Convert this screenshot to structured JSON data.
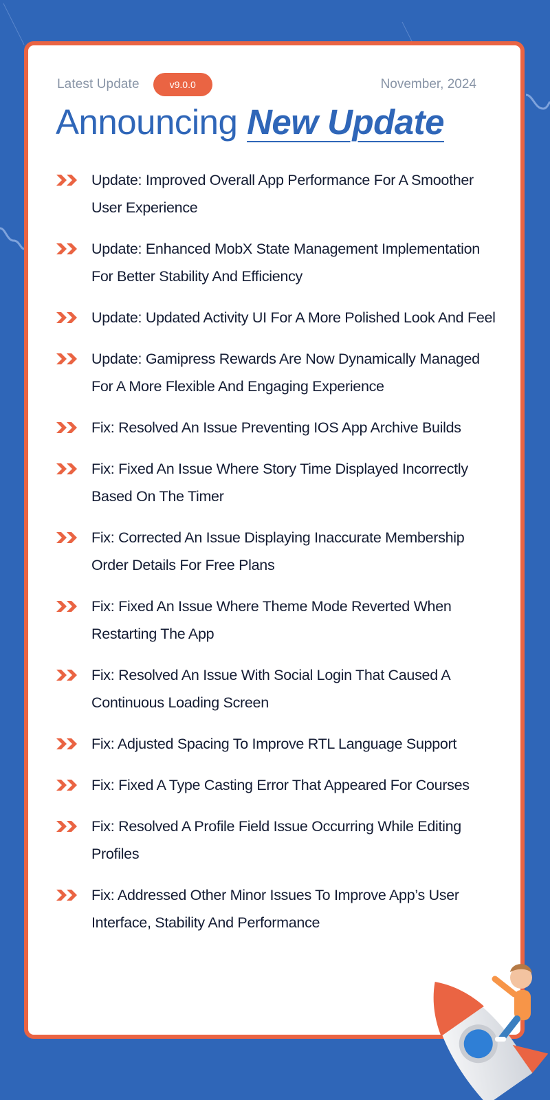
{
  "header": {
    "latest_label": "Latest Update",
    "version": "v9.0.0",
    "date": "November, 2024",
    "headline_plain": "Announcing",
    "headline_accent": "New Update"
  },
  "colors": {
    "background": "#2f66b8",
    "accent": "#ea6443",
    "text": "#141c33",
    "muted": "#8894a6"
  },
  "bullet_icon": "double-chevron-right-icon",
  "items": [
    {
      "text": "Update: Improved Overall App Performance For A Smoother User Experience"
    },
    {
      "text": "Update: Enhanced MobX State Management Implementation For Better Stability And Efficiency"
    },
    {
      "text": "Update: Updated Activity UI For A More Polished Look And Feel"
    },
    {
      "text": "Update: Gamipress Rewards Are Now Dynamically Managed For A More Flexible And Engaging Experience"
    },
    {
      "text": "Fix: Resolved An Issue Preventing IOS App Archive Builds"
    },
    {
      "text": "Fix: Fixed An Issue Where Story Time Displayed Incorrectly Based On The Timer"
    },
    {
      "text": "Fix: Corrected An Issue Displaying Inaccurate Membership Order Details For Free Plans"
    },
    {
      "text": "Fix: Fixed An Issue Where Theme Mode Reverted When Restarting The App"
    },
    {
      "text": "Fix: Resolved An Issue With Social Login That Caused A Continuous Loading Screen"
    },
    {
      "text": "Fix: Adjusted Spacing To Improve RTL Language Support"
    },
    {
      "text": "Fix: Fixed A Type Casting Error That Appeared For Courses"
    },
    {
      "text": "Fix: Resolved A Profile Field Issue Occurring While Editing Profiles"
    },
    {
      "text": "Fix: Addressed Other Minor Issues To Improve App’s User Interface, Stability And Performance"
    }
  ],
  "illustration": "rocket-with-person-illustration"
}
